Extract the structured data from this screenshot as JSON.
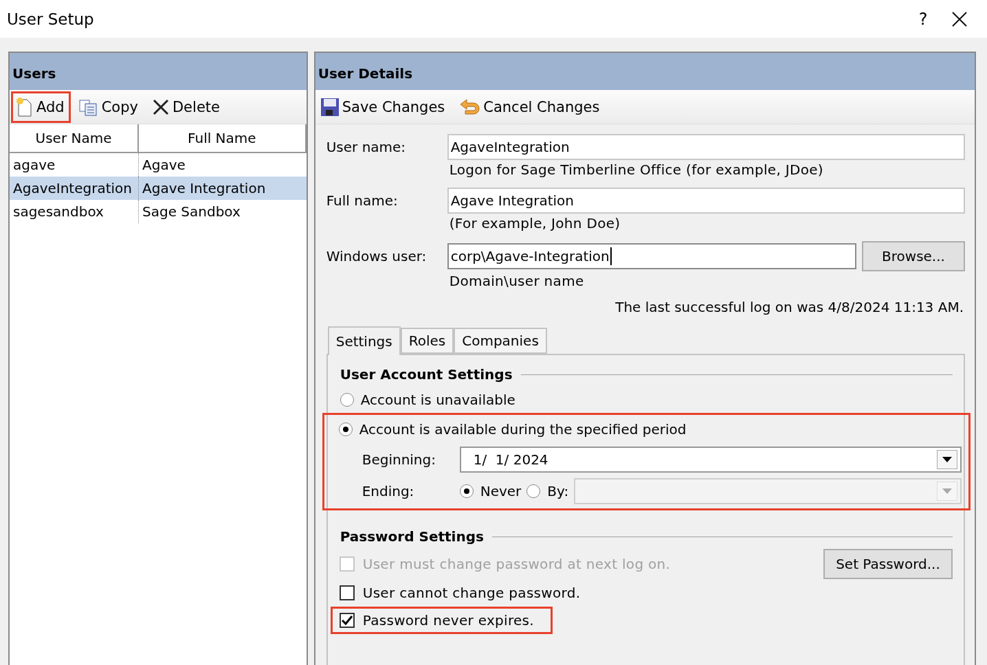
{
  "window": {
    "title": "User Setup",
    "help": "?"
  },
  "users_panel": {
    "title": "Users",
    "toolbar": [
      {
        "kind": "add",
        "label": "Add",
        "highlighted": true
      },
      {
        "kind": "copy",
        "label": "Copy",
        "highlighted": false
      },
      {
        "kind": "delete",
        "label": "Delete",
        "highlighted": false
      }
    ],
    "columns": [
      "User Name",
      "Full Name"
    ],
    "rows": [
      {
        "cells": [
          "agave",
          "Agave"
        ],
        "selected": false
      },
      {
        "cells": [
          "AgaveIntegration",
          "Agave Integration"
        ],
        "selected": true
      },
      {
        "cells": [
          "sagesandbox",
          "Sage Sandbox"
        ],
        "selected": false
      }
    ]
  },
  "details_panel": {
    "title": "User Details",
    "toolbar": [
      {
        "kind": "save",
        "label": "Save Changes"
      },
      {
        "kind": "cancel",
        "label": "Cancel Changes"
      }
    ],
    "fields": [
      {
        "label": "User name:",
        "value": "AgaveIntegration",
        "note": "Logon for Sage Timberline Office (for example, JDoe)",
        "focused": false
      },
      {
        "label": "Full name:",
        "value": "Agave Integration",
        "note": "(For example, John Doe)",
        "focused": false
      },
      {
        "label": "Windows user:",
        "value": "corp\\Agave-Integration",
        "note": "Domain\\user name",
        "button": "Browse...",
        "focused": true
      }
    ],
    "last_logon": "The last successful log on was 4/8/2024 11:13 AM.",
    "tabs": [
      {
        "label": "Settings",
        "selected": true
      },
      {
        "label": "Roles",
        "selected": false
      },
      {
        "label": "Companies",
        "selected": false
      }
    ],
    "account_settings": {
      "title": "User Account Settings",
      "highlighted": true,
      "options": [
        {
          "label": "Account is unavailable",
          "selected": false
        },
        {
          "label": "Account is available during the specified period",
          "selected": true
        }
      ],
      "beginning": {
        "label": "Beginning:",
        "value": "1/  1/ 2024"
      },
      "ending": {
        "label": "Ending:",
        "options": [
          {
            "label": "Never",
            "selected": true
          },
          {
            "label": "By:",
            "selected": false
          }
        ],
        "date_disabled": true
      }
    },
    "password_settings": {
      "title": "Password Settings",
      "button": "Set Password...",
      "checkboxes": [
        {
          "label": "User must change password at next log on.",
          "checked": false,
          "disabled": true,
          "highlighted": false
        },
        {
          "label": "User cannot change password.",
          "checked": false,
          "disabled": false,
          "highlighted": false
        },
        {
          "label": "Password never expires.",
          "checked": true,
          "disabled": false,
          "highlighted": true
        }
      ]
    }
  }
}
